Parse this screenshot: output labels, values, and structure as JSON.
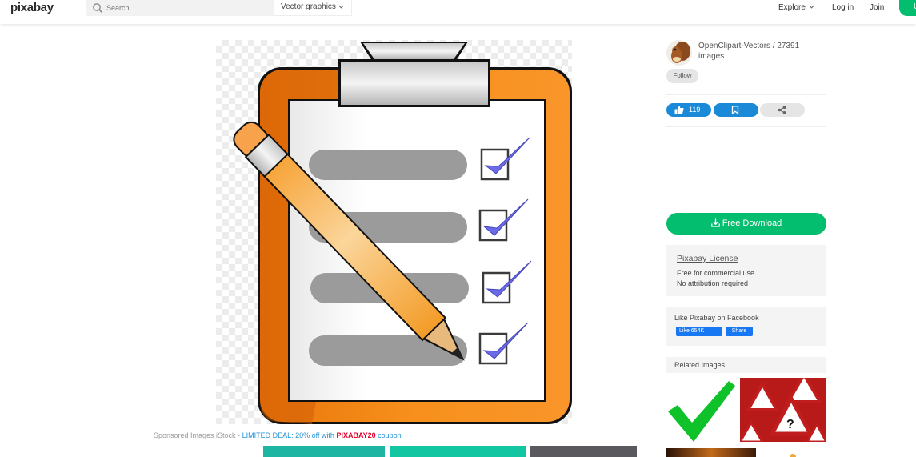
{
  "header": {
    "logo": "pixabay",
    "search_placeholder": "Search",
    "search_type": "Vector graphics",
    "nav": {
      "explore": "Explore",
      "login": "Log in",
      "join": "Join",
      "upload": "U"
    }
  },
  "author": {
    "name": "OpenClipart-Vectors / 27391 images",
    "follow": "Follow"
  },
  "actions": {
    "likes": "119"
  },
  "download": {
    "label": "Free Download"
  },
  "license": {
    "title": "Pixabay License",
    "line1": "Free for commercial use",
    "line2": "No attribution required"
  },
  "facebook": {
    "text": "Like Pixabay on Facebook",
    "like": "Like 654K",
    "share": "Share"
  },
  "related": {
    "title": "Related Images"
  },
  "sponsored": {
    "prefix": "Sponsored Images iStock - ",
    "deal": "LIMITED DEAL: 20% off with ",
    "code": "PIXABAY20",
    "suffix": " coupon"
  },
  "colors": {
    "brand_green": "#02be6e",
    "action_blue": "#1a8ad8",
    "clipboard_orange": "#f5860f",
    "check_blue": "#6b6be8"
  }
}
